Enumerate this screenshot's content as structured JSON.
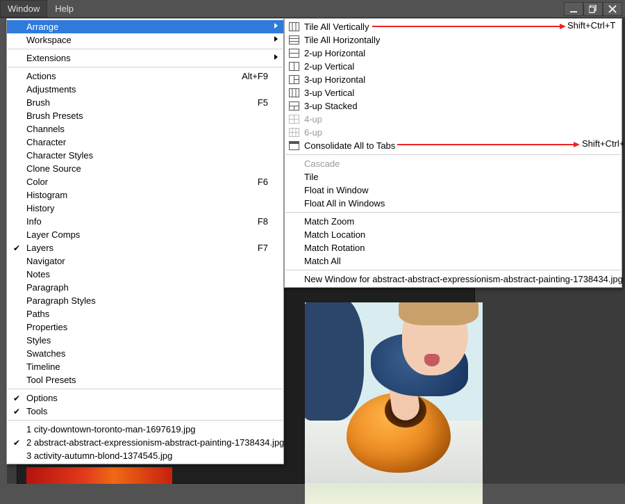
{
  "menubar": {
    "window": "Window",
    "help": "Help"
  },
  "left_menu": {
    "arrange": "Arrange",
    "workspace": "Workspace",
    "extensions": "Extensions",
    "items": [
      {
        "label": "Actions",
        "shortcut": "Alt+F9"
      },
      {
        "label": "Adjustments"
      },
      {
        "label": "Brush",
        "shortcut": "F5"
      },
      {
        "label": "Brush Presets"
      },
      {
        "label": "Channels"
      },
      {
        "label": "Character"
      },
      {
        "label": "Character Styles"
      },
      {
        "label": "Clone Source"
      },
      {
        "label": "Color",
        "shortcut": "F6"
      },
      {
        "label": "Histogram"
      },
      {
        "label": "History"
      },
      {
        "label": "Info",
        "shortcut": "F8"
      },
      {
        "label": "Layer Comps"
      },
      {
        "label": "Layers",
        "shortcut": "F7",
        "checked": true
      },
      {
        "label": "Navigator"
      },
      {
        "label": "Notes"
      },
      {
        "label": "Paragraph"
      },
      {
        "label": "Paragraph Styles"
      },
      {
        "label": "Paths"
      },
      {
        "label": "Properties"
      },
      {
        "label": "Styles"
      },
      {
        "label": "Swatches"
      },
      {
        "label": "Timeline"
      },
      {
        "label": "Tool Presets"
      }
    ],
    "options": "Options",
    "tools": "Tools",
    "docs": [
      "1 city-downtown-toronto-man-1697619.jpg",
      "2 abstract-abstract-expressionism-abstract-painting-1738434.jpg",
      "3 activity-autumn-blond-1374545.jpg"
    ]
  },
  "right_menu": {
    "tile_v": "Tile All Vertically",
    "tile_h": "Tile All Horizontally",
    "two_h": "2-up Horizontal",
    "two_v": "2-up Vertical",
    "three_h": "3-up Horizontal",
    "three_v": "3-up Vertical",
    "three_s": "3-up Stacked",
    "four": "4-up",
    "six": "6-up",
    "consolidate": "Consolidate All to Tabs",
    "cascade": "Cascade",
    "tile": "Tile",
    "float": "Float in Window",
    "float_all": "Float All in Windows",
    "match_zoom": "Match Zoom",
    "match_loc": "Match Location",
    "match_rot": "Match Rotation",
    "match_all": "Match All",
    "new_window": "New Window for abstract-abstract-expressionism-abstract-painting-1738434.jpg"
  },
  "annotations": {
    "sc1": "Shift+Ctrl+T",
    "sc2": "Shift+Ctrl+R"
  }
}
